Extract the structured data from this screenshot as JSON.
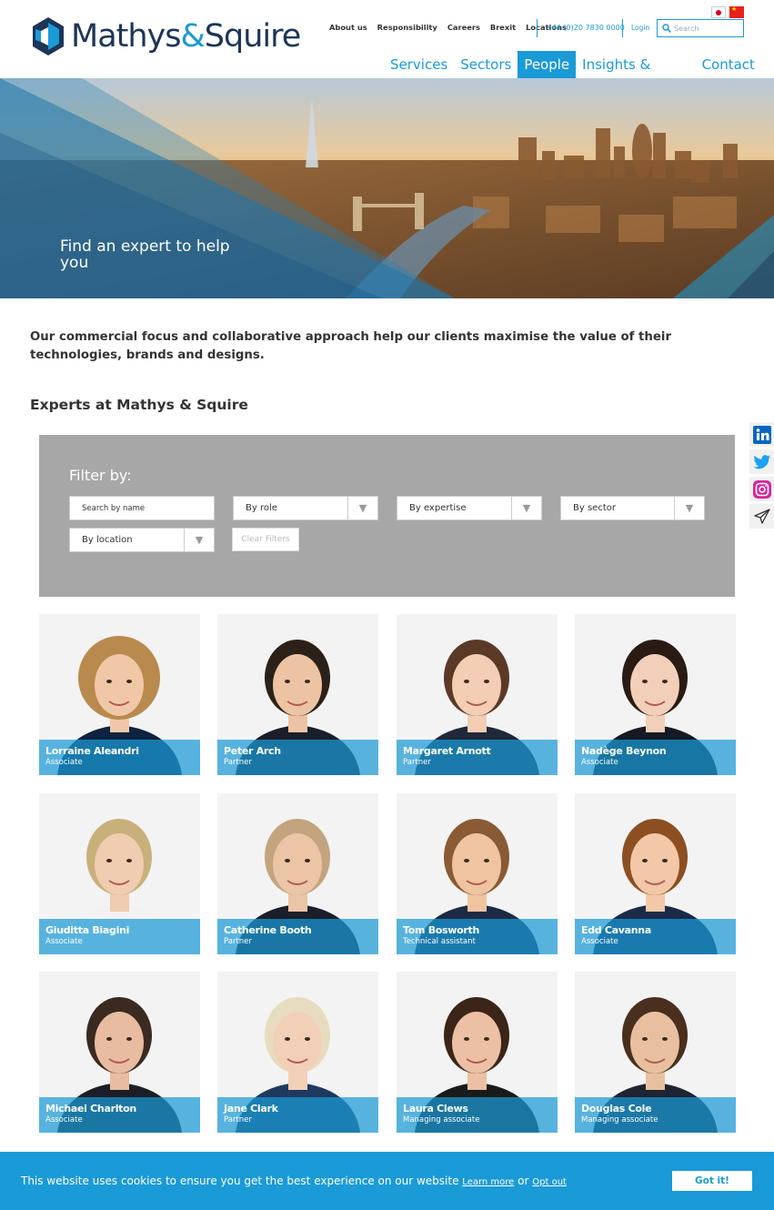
{
  "header": {
    "logo": {
      "part1": "Mathys",
      "amp": "&",
      "part2": "Squire"
    },
    "top_links": [
      "About us",
      "Responsibility",
      "Careers",
      "Brexit",
      "Locations"
    ],
    "phone": "+44 (0)20 7830 0000",
    "login": "Login",
    "search_placeholder": "Search",
    "main_nav": [
      {
        "label": "Services",
        "active": false
      },
      {
        "label": "Sectors",
        "active": false
      },
      {
        "label": "People",
        "active": true
      },
      {
        "label": "Insights & events",
        "active": false
      },
      {
        "label": "Contact us",
        "active": false
      }
    ]
  },
  "hero": {
    "title": "Find an expert to help you"
  },
  "intro": "Our commercial focus and collaborative approach help our clients maximise the value of their technologies, brands and designs.",
  "experts_title": "Experts at Mathys & Squire",
  "filter": {
    "title": "Filter by:",
    "name_placeholder": "Search by name",
    "role": "By role",
    "expertise": "By expertise",
    "sector": "By sector",
    "location": "By location",
    "clear": "Clear Filters"
  },
  "people": [
    {
      "name": "Lorraine Aleandri",
      "role": "Associate"
    },
    {
      "name": "Peter Arch",
      "role": "Partner"
    },
    {
      "name": "Margaret Arnott",
      "role": "Partner"
    },
    {
      "name": "Nadège Beynon",
      "role": "Associate"
    },
    {
      "name": "Giuditta Biagini",
      "role": "Associate"
    },
    {
      "name": "Catherine Booth",
      "role": "Partner"
    },
    {
      "name": "Tom Bosworth",
      "role": "Technical assistant"
    },
    {
      "name": "Edd Cavanna",
      "role": "Associate"
    },
    {
      "name": "Michael Charlton",
      "role": "Associate"
    },
    {
      "name": "Jane Clark",
      "role": "Partner"
    },
    {
      "name": "Laura Clews",
      "role": "Managing associate"
    },
    {
      "name": "Douglas Cole",
      "role": "Managing associate"
    }
  ],
  "cookie": {
    "text": "This website uses cookies to ensure you get the best experience on our website",
    "learn_more": "Learn more",
    "or": "or",
    "opt_out": "Opt out",
    "button": "Got it!"
  },
  "colors": {
    "brand_blue": "#1a9ad6",
    "navy": "#1d3557",
    "filter_grey": "#a7a7a7"
  },
  "social_icons": [
    "linkedin-icon",
    "twitter-icon",
    "instagram-icon",
    "send-icon"
  ]
}
